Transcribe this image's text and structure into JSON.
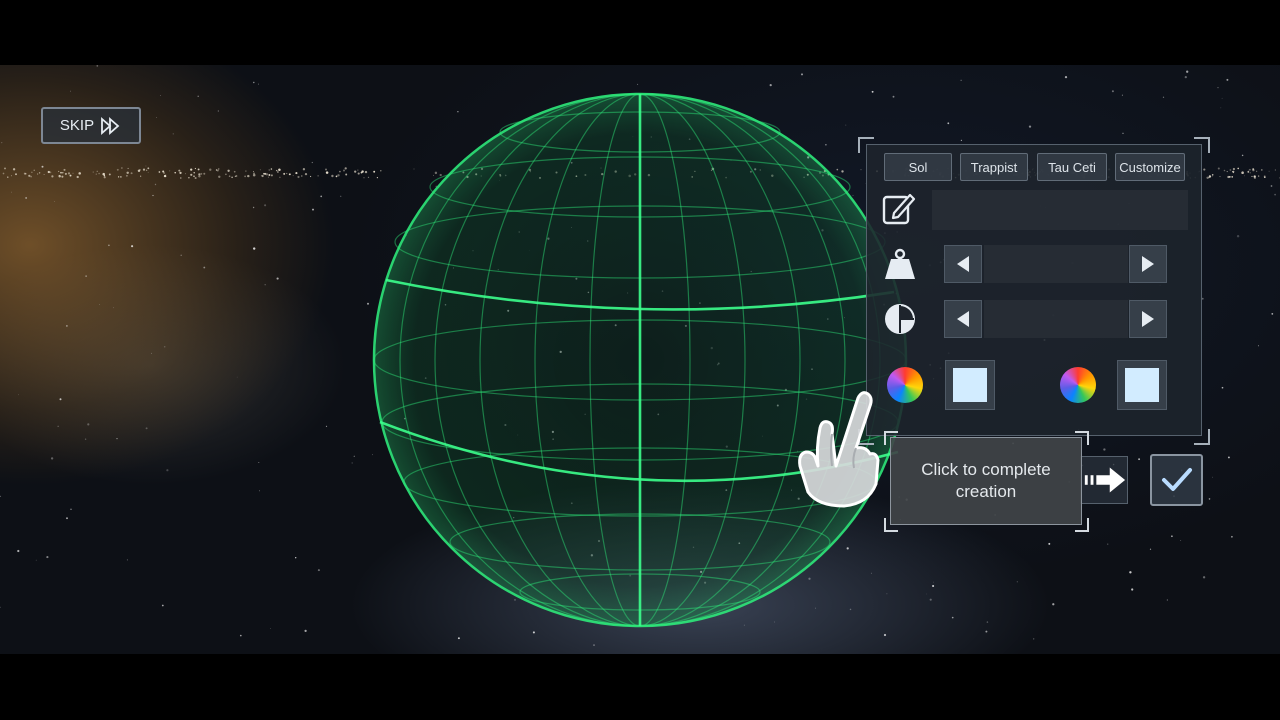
{
  "skip": {
    "label": "SKIP",
    "icon": "fast-forward-icon"
  },
  "presets": {
    "tabs": [
      {
        "label": "Sol"
      },
      {
        "label": "Trappist"
      },
      {
        "label": "Tau Ceti"
      },
      {
        "label": "Customize"
      }
    ]
  },
  "name_row": {
    "icon": "pencil-icon",
    "value": ""
  },
  "mass_row": {
    "icon": "weight-icon",
    "value": ""
  },
  "phase_row": {
    "icon": "pie-chart-icon",
    "value": ""
  },
  "color_row": {
    "primary": {
      "wheel_icon": "color-wheel-icon",
      "swatch": "#d2ecff"
    },
    "secondary": {
      "wheel_icon": "color-wheel-icon",
      "swatch": "#d2ecff"
    }
  },
  "tooltip": {
    "text": "Click to complete creation"
  },
  "colors": {
    "planet_grid": "#2ee87a",
    "panel_bg": "#1e242c",
    "swatch": "#d2ecff"
  }
}
